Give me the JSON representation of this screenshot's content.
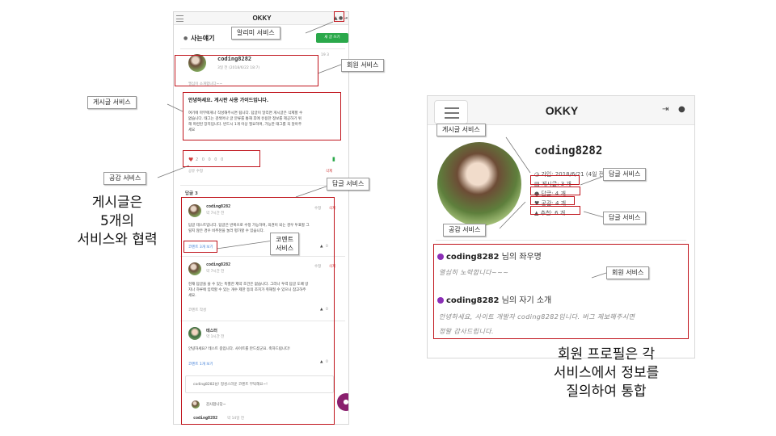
{
  "phone": {
    "logo": "OKKY",
    "section_title": "사는얘기",
    "write_button": "새 글 쓰기",
    "header_counts": "19  3",
    "author": "coding8282",
    "author_time": "3일 전 (2018/6/22 18:7)",
    "post_subtitle": "엘심이 소개합니다~~",
    "post_title": "안녕하세요. 게시판 사용 가이드입니다.",
    "post_body": [
      "여기에 마무에게나 작성해주시면 됩니다. 답글이 달리면 게시글은 삭제할 수",
      "없습니다. 태그는 검색어나 글 분류를 통해 후에 유용한 정보를 제공하기 위",
      "해 마련된 장치입니다. 반드시 1개 이상 필요하며, 가능한 태그를 꼭 달아주",
      "세요"
    ],
    "reactions": "2  0  0  0  0",
    "post_actions": "공유  수정",
    "post_delete": "삭제",
    "answer_count": "답글 3",
    "comments": [
      {
        "author": "coding8282",
        "time": "약 7시간 전",
        "edit": "수정",
        "delete": "삭제",
        "text": [
          "답글 테스트입니다. 답글은 반복으로 수정 가능하며, 의견이 되는 경우 투표할 그",
          "릴지 않은 경우 비추천을 눌러 평가할 수 있습니다."
        ],
        "link": "코멘트 3개 보기",
        "vote": "0"
      },
      {
        "author": "coding8282",
        "time": "약 7시간 전",
        "edit": "수정",
        "delete": "삭제",
        "text": [
          "현재 답글을 쓸 수 있는 특별한 제약 조건은 없습니다. 그러나 투력 답글 도배 방",
          "지나 하루에 입력할 수 있는 개수 제한 등의 조치가 취해질 수 있으니 참고하주",
          "세요."
        ],
        "link": "코멘트 작성",
        "vote": "0"
      },
      {
        "author": "테스터",
        "time": "약 1시간 전",
        "edit": "",
        "delete": "",
        "text": [
          "안녕하세요? 테스트 중입니다. 사이트를 만드셨군요. 축하드립니다!"
        ],
        "link": "코멘트 1개 보기",
        "vote": "0"
      }
    ],
    "comment_preview": "coding8282님! 정성스러운 코멘트 부탁해요~!",
    "nested_text": "감사합니당~",
    "nested_author": "coding8282",
    "nested_time": "약 14일 전"
  },
  "profile": {
    "logo": "OKKY",
    "username": "coding8282",
    "stats": [
      {
        "icon": "clock-icon",
        "text": "가입: 2018/6/21 (4일 전)"
      },
      {
        "icon": "doc-icon",
        "text": "게시글: 3 개"
      },
      {
        "icon": "chat-icon",
        "text": "답글: 4 개"
      },
      {
        "icon": "heart-icon",
        "text": "공감: 4 개"
      },
      {
        "icon": "thumb-icon",
        "text": "추천: 6 개"
      }
    ],
    "section1_user": "coding8282",
    "section1_suffix": " 님의 좌우명",
    "section1_text": "열심히 노력합니다~~~",
    "section2_user": "coding8282",
    "section2_suffix": " 님의 자기 소개",
    "section2_text1": "안녕하세요, 사이트 개발자 coding8282입니다. 버그 제보해주시면",
    "section2_text2": "정말 감사드립니다."
  },
  "annotations": {
    "notification_service": "알리미 서비스",
    "member_service": "회원 서비스",
    "post_service": "게시글 서비스",
    "like_service": "공감 서비스",
    "answer_service": "답글 서비스",
    "comment_service_1": "코멘트",
    "comment_service_2": "서비스",
    "right_post_service": "게시글 서비스",
    "right_answer_service_1": "답글 서비스",
    "right_answer_service_2": "답글 서비스",
    "right_like_service": "공감 서비스",
    "right_member_service": "회원 서비스"
  },
  "captions": {
    "left_line1": "게시글은",
    "left_line2": "5개의",
    "left_line3": "서비스와 협력",
    "right_line1": "회원 프로필은 각",
    "right_line2": "서비스에서 정보를",
    "right_line3": "질의하여 통합"
  },
  "colors": {
    "annotation": "#c0141c",
    "brand_green": "#2aa84a",
    "fab": "#8a1f6e",
    "accent_purple": "#8b2fb6"
  }
}
